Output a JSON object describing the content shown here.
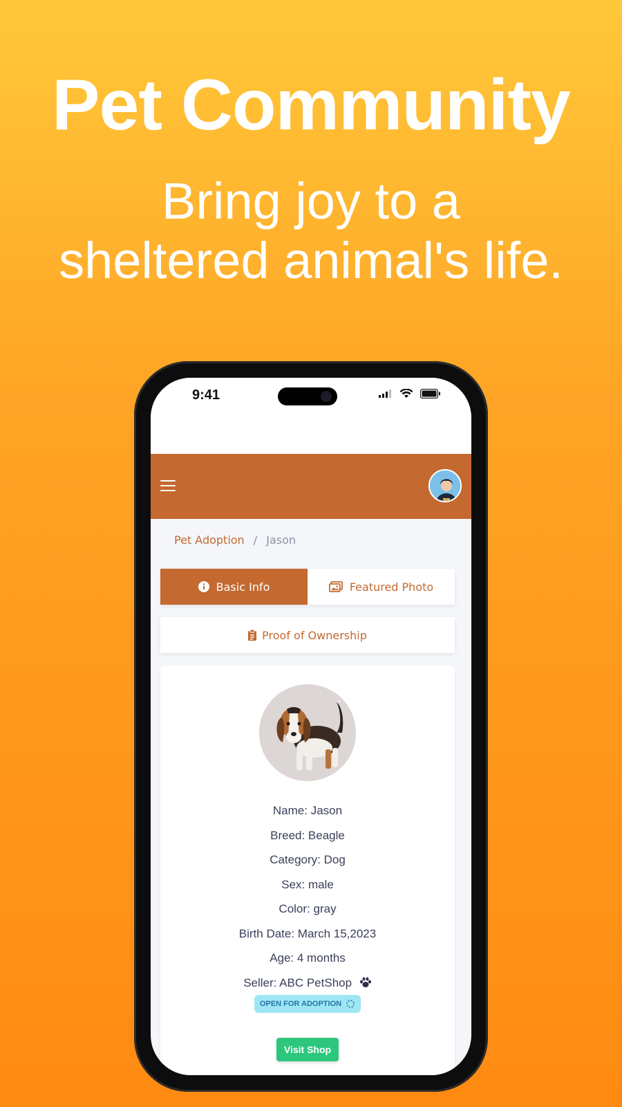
{
  "hero": {
    "title": "Pet Community",
    "subtitle_line1": "Bring joy to a",
    "subtitle_line2": "sheltered animal's life."
  },
  "status_bar": {
    "time": "9:41"
  },
  "colors": {
    "accent": "#c4692f",
    "success": "#2cc77d",
    "badge_bg": "#9fe6f5"
  },
  "breadcrumb": {
    "parent": "Pet Adoption",
    "separator": "/",
    "current": "Jason"
  },
  "tabs": [
    {
      "label": "Basic Info",
      "icon": "info-circle-icon",
      "active": true
    },
    {
      "label": "Featured Photo",
      "icon": "images-icon",
      "active": false
    }
  ],
  "proof": {
    "label": "Proof of Ownership",
    "icon": "clipboard-icon"
  },
  "pet": {
    "photo_icon": "beagle-puppy-photo",
    "name": "Name: Jason",
    "breed": "Breed: Beagle",
    "category": "Category: Dog",
    "sex": "Sex: male",
    "color": "Color: gray",
    "birth_date": "Birth Date: March 15,2023",
    "age": "Age: 4 months",
    "seller": "Seller: ABC PetShop"
  },
  "badge": {
    "label": "OPEN FOR ADOPTION",
    "icon": "spinner-icon"
  },
  "actions": {
    "visit_shop": "Visit Shop"
  }
}
